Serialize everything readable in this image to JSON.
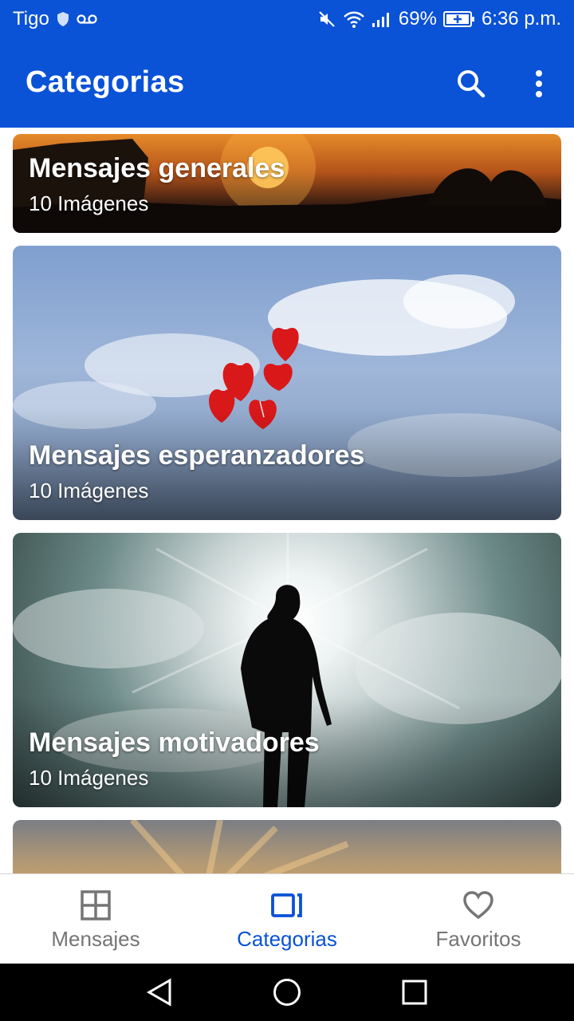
{
  "status_bar": {
    "carrier": "Tigo",
    "battery": "69%",
    "time": "6:36 p.m."
  },
  "app_bar": {
    "title": "Categorias",
    "search_icon": "search-icon",
    "more_icon": "more-vert-icon"
  },
  "categories": [
    {
      "title": "Mensajes generales",
      "count": "10 Imágenes"
    },
    {
      "title": "Mensajes esperanzadores",
      "count": "10 Imágenes"
    },
    {
      "title": "Mensajes motivadores",
      "count": "10 Imágenes"
    }
  ],
  "bottom_nav": {
    "items": [
      {
        "label": "Mensajes",
        "icon": "grid-icon"
      },
      {
        "label": "Categorias",
        "icon": "categories-icon"
      },
      {
        "label": "Favoritos",
        "icon": "heart-icon"
      }
    ],
    "active": "Categorias"
  },
  "colors": {
    "primary": "#0a52d6",
    "nav_inactive": "#757575"
  }
}
